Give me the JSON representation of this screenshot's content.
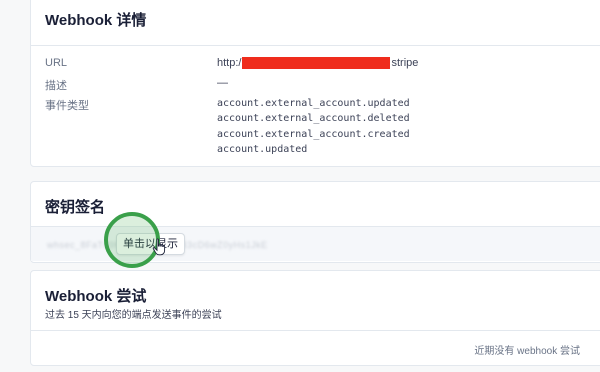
{
  "webhook_details": {
    "title": "Webhook 详情",
    "url_label": "URL",
    "url_prefix": "http:/",
    "url_suffix": "stripe",
    "description_label": "描述",
    "description_value": "—",
    "event_types_label": "事件类型",
    "event_types": [
      "account.external_account.updated",
      "account.external_account.deleted",
      "account.external_account.created",
      "account.updated"
    ]
  },
  "signing_secret": {
    "title": "密钥签名",
    "masked_secret": "whsec_8FaTq9K2mR7pLx4NvB3cD6wZ0yHs1JkE",
    "reveal_button": "单击以显示"
  },
  "webhook_attempts": {
    "title": "Webhook 尝试",
    "subtitle": "过去 15 天内向您的端点发送事件的尝试",
    "empty_state": "近期没有 webhook 尝试"
  },
  "colors": {
    "redaction": "#ef2c1c",
    "click_indicator": "#3aa04a"
  }
}
